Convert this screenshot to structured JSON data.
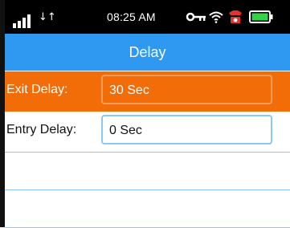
{
  "status_bar": {
    "time": "08:25 AM",
    "data_arrows": "↓↑",
    "icons": [
      "signal-icon",
      "data-transfer-icon",
      "key-icon",
      "wifi-icon",
      "alarm-icon",
      "battery-icon"
    ]
  },
  "header": {
    "title": "Delay"
  },
  "settings": {
    "exit_delay": {
      "label": "Exit Delay:",
      "value": "30 Sec"
    },
    "entry_delay": {
      "label": "Entry Delay:",
      "value": "0 Sec"
    }
  },
  "colors": {
    "title_bar": "#2f98f0",
    "selected_row": "#f26c07",
    "field_border": "#8cc7f5",
    "battery": "#35d14a",
    "alarm": "#e2342d"
  }
}
